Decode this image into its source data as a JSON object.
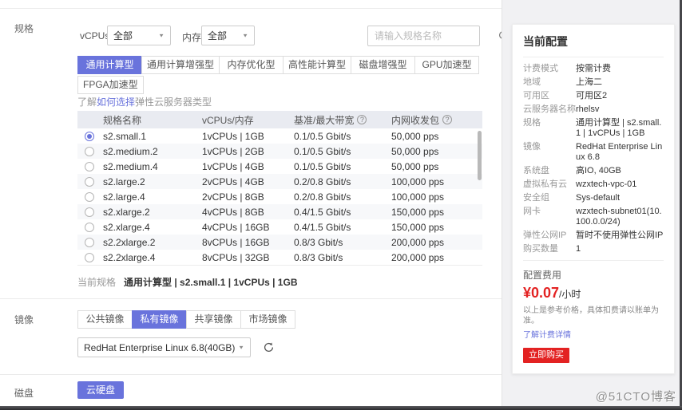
{
  "colors": {
    "accent": "#6973dc",
    "price_red": "#e32222",
    "table_header_bg": "#e9ebf1"
  },
  "icons": {
    "caret_down": "▼",
    "help": "?",
    "search": "magnifier",
    "refresh": "circular-arrow"
  },
  "spec_section": {
    "label": "规格",
    "vcpus_label": "vCPUs",
    "vcpus_value": "全部",
    "memory_label": "内存",
    "memory_value": "全部",
    "search_placeholder": "请输入规格名称",
    "tabs": [
      "通用计算型",
      "通用计算增强型",
      "内存优化型",
      "高性能计算型",
      "磁盘增强型",
      "GPU加速型",
      "FPGA加速型"
    ],
    "active_tab": "通用计算型",
    "learn_prefix": "了解",
    "learn_link": "如何选择",
    "learn_suffix": "弹性云服务器类型",
    "table": {
      "headers": [
        "规格名称",
        "vCPUs/内存",
        "基准/最大带宽",
        "内网收发包"
      ],
      "rows": [
        {
          "name": "s2.small.1",
          "spec": "1vCPUs | 1GB",
          "bandwidth": "0.1/0.5 Gbit/s",
          "pps": "50,000 pps",
          "selected": true
        },
        {
          "name": "s2.medium.2",
          "spec": "1vCPUs | 2GB",
          "bandwidth": "0.1/0.5 Gbit/s",
          "pps": "50,000 pps",
          "selected": false
        },
        {
          "name": "s2.medium.4",
          "spec": "1vCPUs | 4GB",
          "bandwidth": "0.1/0.5 Gbit/s",
          "pps": "50,000 pps",
          "selected": false
        },
        {
          "name": "s2.large.2",
          "spec": "2vCPUs | 4GB",
          "bandwidth": "0.2/0.8 Gbit/s",
          "pps": "100,000 pps",
          "selected": false
        },
        {
          "name": "s2.large.4",
          "spec": "2vCPUs | 8GB",
          "bandwidth": "0.2/0.8 Gbit/s",
          "pps": "100,000 pps",
          "selected": false
        },
        {
          "name": "s2.xlarge.2",
          "spec": "4vCPUs | 8GB",
          "bandwidth": "0.4/1.5 Gbit/s",
          "pps": "150,000 pps",
          "selected": false
        },
        {
          "name": "s2.xlarge.4",
          "spec": "4vCPUs | 16GB",
          "bandwidth": "0.4/1.5 Gbit/s",
          "pps": "150,000 pps",
          "selected": false
        },
        {
          "name": "s2.2xlarge.2",
          "spec": "8vCPUs | 16GB",
          "bandwidth": "0.8/3 Gbit/s",
          "pps": "200,000 pps",
          "selected": false
        },
        {
          "name": "s2.2xlarge.4",
          "spec": "8vCPUs | 32GB",
          "bandwidth": "0.8/3 Gbit/s",
          "pps": "200,000 pps",
          "selected": false
        }
      ]
    },
    "current_spec_label": "当前规格",
    "current_spec_value": "通用计算型 | s2.small.1 | 1vCPUs | 1GB"
  },
  "image_section": {
    "label": "镜像",
    "tabs": [
      "公共镜像",
      "私有镜像",
      "共享镜像",
      "市场镜像"
    ],
    "active_tab": "私有镜像",
    "selected_image": "RedHat Enterprise Linux 6.8(40GB)"
  },
  "disk_section": {
    "label": "磁盘",
    "button": "云硬盘"
  },
  "config_panel": {
    "title": "当前配置",
    "items": [
      {
        "label": "计费模式",
        "value": "按需计费"
      },
      {
        "label": "地域",
        "value": "上海二"
      },
      {
        "label": "可用区",
        "value": "可用区2"
      },
      {
        "label": "云服务器名称",
        "value": "rhelsv"
      },
      {
        "label": "规格",
        "value": "通用计算型 | s2.small.1 | 1vCPUs | 1GB"
      },
      {
        "label": "镜像",
        "value": "RedHat Enterprise Linux 6.8"
      },
      {
        "label": "系统盘",
        "value": "高IO, 40GB"
      },
      {
        "label": "虚拟私有云",
        "value": "wzxtech-vpc-01"
      },
      {
        "label": "安全组",
        "value": "Sys-default"
      },
      {
        "label": "网卡",
        "value": "wzxtech-subnet01(10.100.0.0/24)"
      },
      {
        "label": "弹性公网IP",
        "value": "暂时不使用弹性公网IP"
      },
      {
        "label": "购买数量",
        "value": "1"
      }
    ],
    "fee_label": "配置费用",
    "price": "¥0.07",
    "price_unit": "/小时",
    "fee_note": "以上是参考价格，具体扣费请以账单为准。",
    "fee_link": "了解计费详情",
    "buy_button": "立即购买"
  },
  "watermark": "@51CTO博客"
}
